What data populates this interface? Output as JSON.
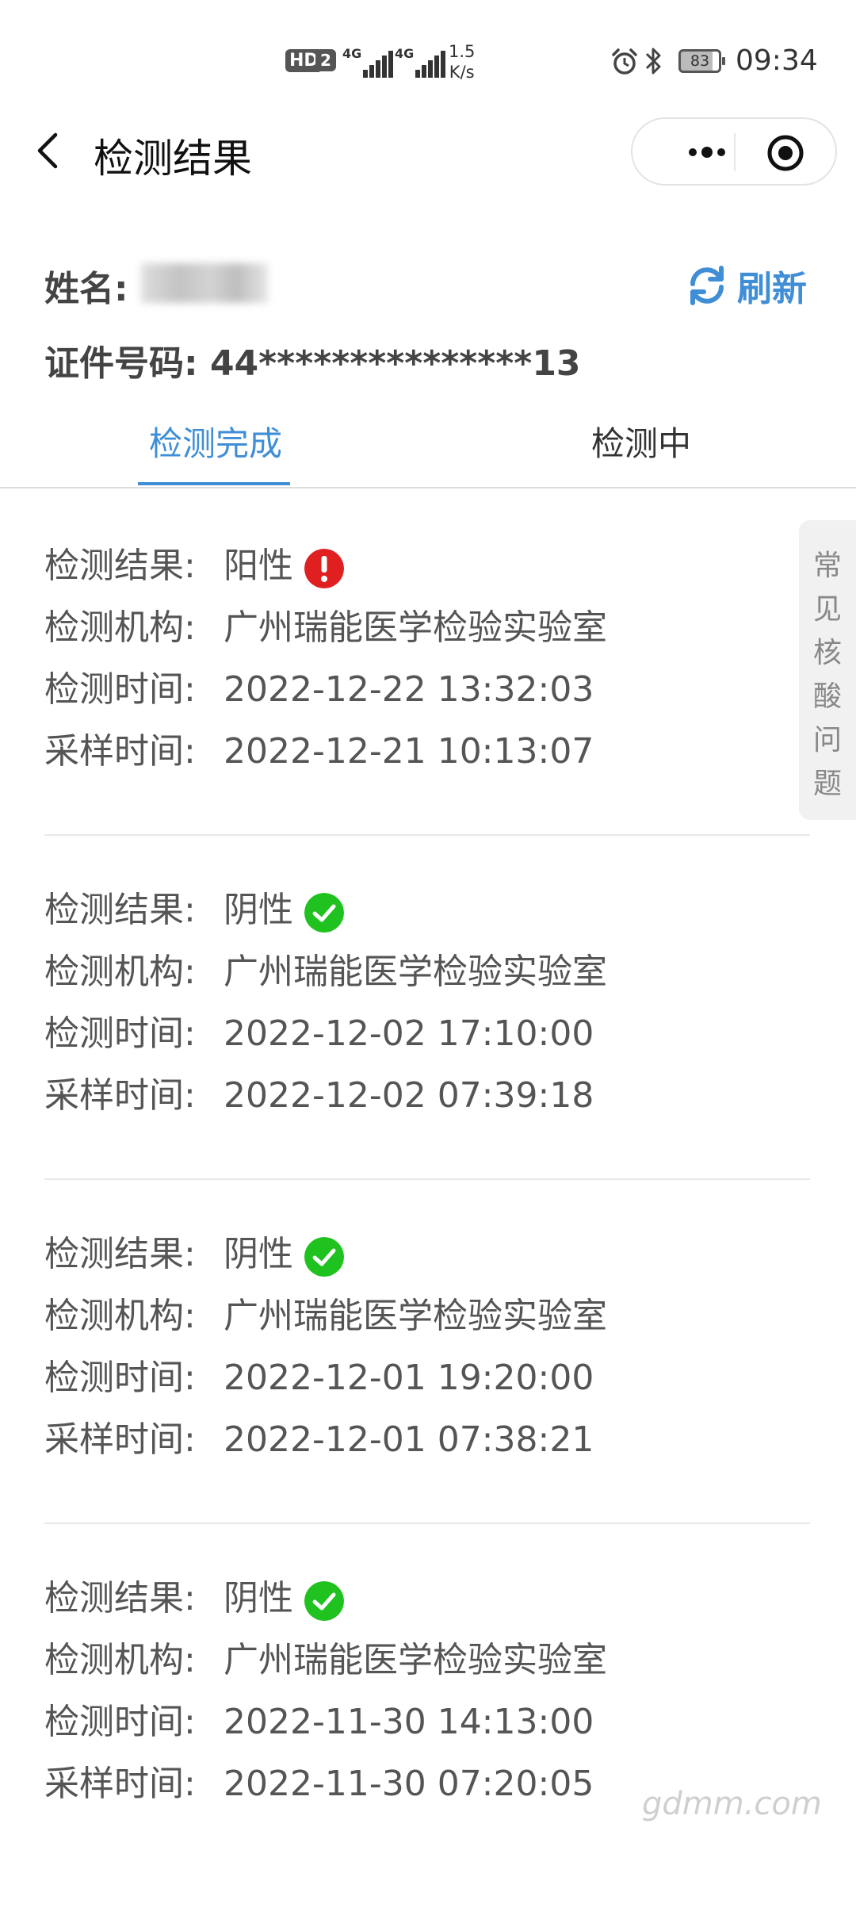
{
  "status_bar": {
    "hd": "HD",
    "sim": "2",
    "signal1": "4G",
    "signal2": "4G",
    "speed_value": "1.5",
    "speed_unit": "K/s",
    "battery": "83",
    "time": "09:34"
  },
  "nav": {
    "title": "检测结果"
  },
  "profile": {
    "name_label": "姓名:",
    "id_label": "证件号码:",
    "id_value": "44***************13",
    "refresh_label": "刷新"
  },
  "tabs": [
    {
      "label": "检测完成",
      "active": true
    },
    {
      "label": "检测中",
      "active": false
    }
  ],
  "faq_tab": "常见核酸问题",
  "labels": {
    "result": "检测结果:",
    "institution": "检测机构:",
    "test_time": "检测时间:",
    "sample_time": "采样时间:"
  },
  "records": [
    {
      "result": "阳性",
      "status": "positive",
      "institution": "广州瑞能医学检验实验室",
      "test_time": "2022-12-22 13:32:03",
      "sample_time": "2022-12-21 10:13:07"
    },
    {
      "result": "阴性",
      "status": "negative",
      "institution": "广州瑞能医学检验实验室",
      "test_time": "2022-12-02 17:10:00",
      "sample_time": "2022-12-02 07:39:18"
    },
    {
      "result": "阴性",
      "status": "negative",
      "institution": "广州瑞能医学检验实验室",
      "test_time": "2022-12-01 19:20:00",
      "sample_time": "2022-12-01 07:38:21"
    },
    {
      "result": "阴性",
      "status": "negative",
      "institution": "广州瑞能医学检验实验室",
      "test_time": "2022-11-30 14:13:00",
      "sample_time": "2022-11-30 07:20:05"
    }
  ],
  "colors": {
    "accent": "#3f8ed6",
    "positive": "#e02020",
    "negative": "#1fc21f"
  },
  "watermark": "gdmm.com"
}
